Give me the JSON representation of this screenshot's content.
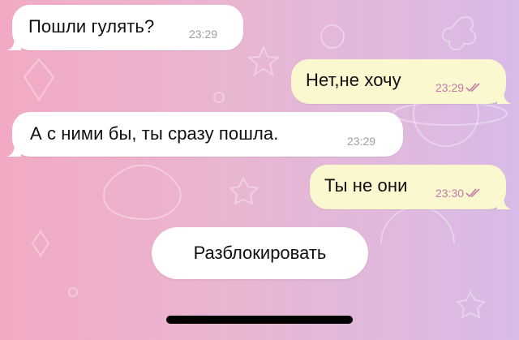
{
  "messages": [
    {
      "direction": "incoming",
      "text": "Пошли гулять?",
      "time": "23:29"
    },
    {
      "direction": "outgoing",
      "text": "Нет,не хочу",
      "time": "23:29",
      "status": "read-double-check"
    },
    {
      "direction": "incoming",
      "text": "А с ними бы, ты сразу пошла.",
      "time": "23:29"
    },
    {
      "direction": "outgoing",
      "text": "Ты не они",
      "time": "23:30",
      "status": "read-double-check"
    }
  ],
  "unblock_button": {
    "label": "Разблокировать"
  },
  "colors": {
    "incoming_bubble": "#ffffff",
    "outgoing_bubble": "#fbf7cf",
    "outgoing_time": "#c27aa6",
    "incoming_time": "#9aa0a6"
  }
}
